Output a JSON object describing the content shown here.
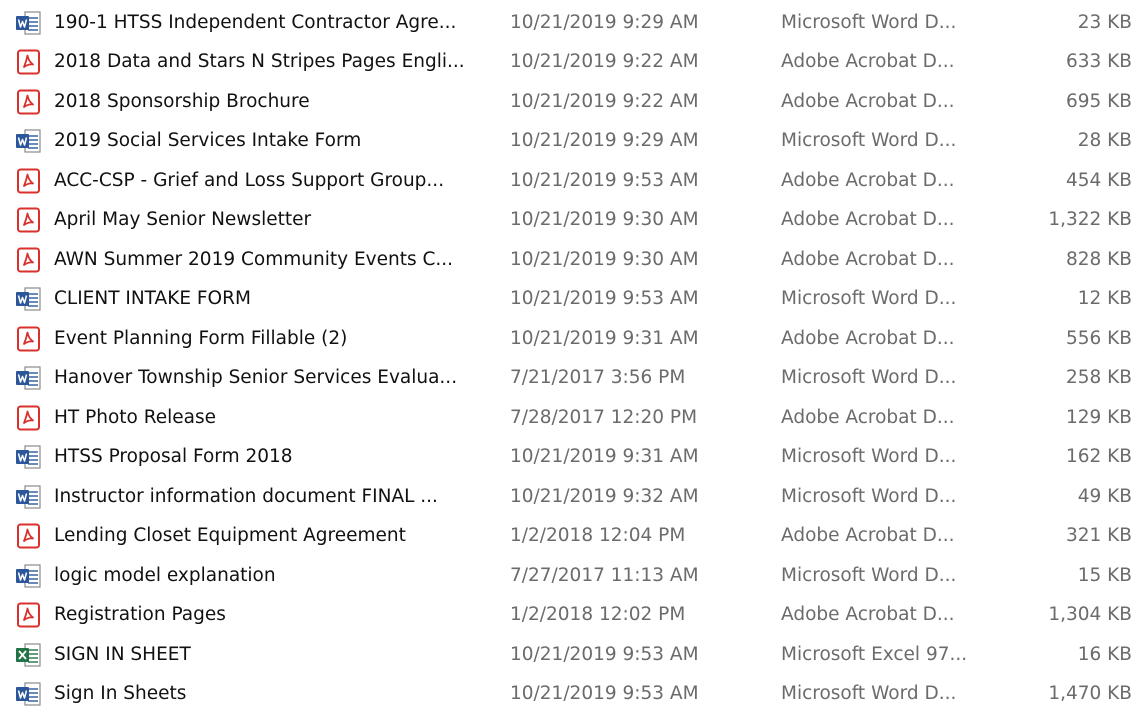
{
  "colors": {
    "word_blue": "#2b579a",
    "pdf_red": "#d9302c",
    "excel_green": "#217346",
    "text_primary": "#111111",
    "text_secondary": "#6b6b6b"
  },
  "files": [
    {
      "name": "190-1 HTSS Independent Contractor Agre...",
      "date": "10/21/2019 9:29 AM",
      "type": "Microsoft Word D...",
      "size": "23 KB",
      "icon": "word-doc-icon"
    },
    {
      "name": "2018 Data and Stars N Stripes Pages Engli...",
      "date": "10/21/2019 9:22 AM",
      "type": "Adobe Acrobat D...",
      "size": "633 KB",
      "icon": "pdf-doc-icon"
    },
    {
      "name": "2018 Sponsorship Brochure",
      "date": "10/21/2019 9:22 AM",
      "type": "Adobe Acrobat D...",
      "size": "695 KB",
      "icon": "pdf-doc-icon"
    },
    {
      "name": "2019 Social Services Intake Form",
      "date": "10/21/2019 9:29 AM",
      "type": "Microsoft Word D...",
      "size": "28 KB",
      "icon": "word-doc-icon"
    },
    {
      "name": "ACC-CSP - Grief and Loss Support Group...",
      "date": "10/21/2019 9:53 AM",
      "type": "Adobe Acrobat D...",
      "size": "454 KB",
      "icon": "pdf-doc-icon"
    },
    {
      "name": "April May Senior Newsletter",
      "date": "10/21/2019 9:30 AM",
      "type": "Adobe Acrobat D...",
      "size": "1,322 KB",
      "icon": "pdf-doc-icon"
    },
    {
      "name": "AWN Summer 2019 Community Events C...",
      "date": "10/21/2019 9:30 AM",
      "type": "Adobe Acrobat D...",
      "size": "828 KB",
      "icon": "pdf-doc-icon"
    },
    {
      "name": "CLIENT INTAKE FORM",
      "date": "10/21/2019 9:53 AM",
      "type": "Microsoft Word D...",
      "size": "12 KB",
      "icon": "word-doc-icon"
    },
    {
      "name": "Event Planning Form Fillable (2)",
      "date": "10/21/2019 9:31 AM",
      "type": "Adobe Acrobat D...",
      "size": "556 KB",
      "icon": "pdf-doc-icon"
    },
    {
      "name": "Hanover Township Senior Services Evalua...",
      "date": "7/21/2017 3:56 PM",
      "type": "Microsoft Word D...",
      "size": "258 KB",
      "icon": "word-doc-icon"
    },
    {
      "name": "HT Photo Release",
      "date": "7/28/2017 12:20 PM",
      "type": "Adobe Acrobat D...",
      "size": "129 KB",
      "icon": "pdf-doc-icon"
    },
    {
      "name": "HTSS Proposal Form 2018",
      "date": "10/21/2019 9:31 AM",
      "type": "Microsoft Word D...",
      "size": "162 KB",
      "icon": "word-doc-icon"
    },
    {
      "name": "Instructor information document FINAL ...",
      "date": "10/21/2019 9:32 AM",
      "type": "Microsoft Word D...",
      "size": "49 KB",
      "icon": "word-doc-icon"
    },
    {
      "name": "Lending Closet Equipment Agreement",
      "date": "1/2/2018 12:04 PM",
      "type": "Adobe Acrobat D...",
      "size": "321 KB",
      "icon": "pdf-doc-icon"
    },
    {
      "name": "logic model explanation",
      "date": "7/27/2017 11:13 AM",
      "type": "Microsoft Word D...",
      "size": "15 KB",
      "icon": "word-doc-icon"
    },
    {
      "name": "Registration Pages",
      "date": "1/2/2018 12:02 PM",
      "type": "Adobe Acrobat D...",
      "size": "1,304 KB",
      "icon": "pdf-doc-icon"
    },
    {
      "name": "SIGN IN SHEET",
      "date": "10/21/2019 9:53 AM",
      "type": "Microsoft Excel 97...",
      "size": "16 KB",
      "icon": "excel-doc-icon"
    },
    {
      "name": "Sign In Sheets",
      "date": "10/21/2019 9:53 AM",
      "type": "Microsoft Word D...",
      "size": "1,470 KB",
      "icon": "word-doc-icon"
    }
  ]
}
